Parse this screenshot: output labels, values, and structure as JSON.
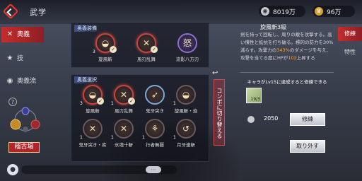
{
  "header": {
    "title": "武学",
    "currency1": {
      "value": "8019万",
      "icon": "silver-coin-icon"
    },
    "currency2": {
      "value": "96万",
      "icon": "gold-wings-icon"
    }
  },
  "left_nav": {
    "items": [
      {
        "label": "奥義",
        "icon": "x"
      },
      {
        "label": "技",
        "icon": "★"
      },
      {
        "label": "奥義流",
        "icon": "◉"
      }
    ],
    "active": 0,
    "help": "?",
    "practice_button": "稽古場"
  },
  "equip_panel": {
    "title": "奥義装備",
    "slots": [
      {
        "label": "旋風斬",
        "level": "3",
        "glyph": "◒"
      },
      {
        "label": "風刃乱舞",
        "level": "",
        "glyph": "✕"
      },
      {
        "label": "流影八方刃",
        "level": "",
        "glyph": "怒"
      }
    ]
  },
  "select_panel": {
    "title": "奥義選択",
    "toggle_label": "コンボに切り替える",
    "skills": [
      {
        "label": "旋風斬",
        "level": "3",
        "glyph": "◒"
      },
      {
        "label": "風刃乱舞",
        "level": "1",
        "glyph": "✕"
      },
      {
        "label": "鬼牙突き",
        "level": "",
        "glyph": "➶"
      },
      {
        "label": "旋風斬・焔",
        "level": "1",
        "glyph": "◒"
      },
      {
        "label": "鬼牙突き・疾",
        "level": "1",
        "glyph": "✕"
      },
      {
        "label": "氷魂十斬",
        "level": "1",
        "glyph": "✕"
      },
      {
        "label": "行者無疆",
        "level": "1",
        "glyph": "⚘"
      },
      {
        "label": "月牙連斬",
        "level": "1",
        "glyph": "↺"
      }
    ]
  },
  "detail": {
    "title": "旋風斬3級",
    "desc_pre": "剣を持って回転し、周りの敵を攻撃する。高い慣性と抵抗を打ち破る。標的の防力を30%減らす。攻撃力の",
    "desc_hl1": "343%",
    "desc_mid": "のダメージを与え、攻撃を当てる度にHPが",
    "desc_hl2": "102",
    "desc_post": "上昇する",
    "requirement": "キャラがLv15に達成すると修練できる",
    "item_count": "19/3",
    "cost": "2050",
    "train_button": "修練",
    "remove_button": "取り外す"
  },
  "right_tabs": [
    "修練",
    "特性"
  ],
  "colors": {
    "accent_red": "#c42d2d",
    "highlight_orange": "#f0a43a"
  }
}
